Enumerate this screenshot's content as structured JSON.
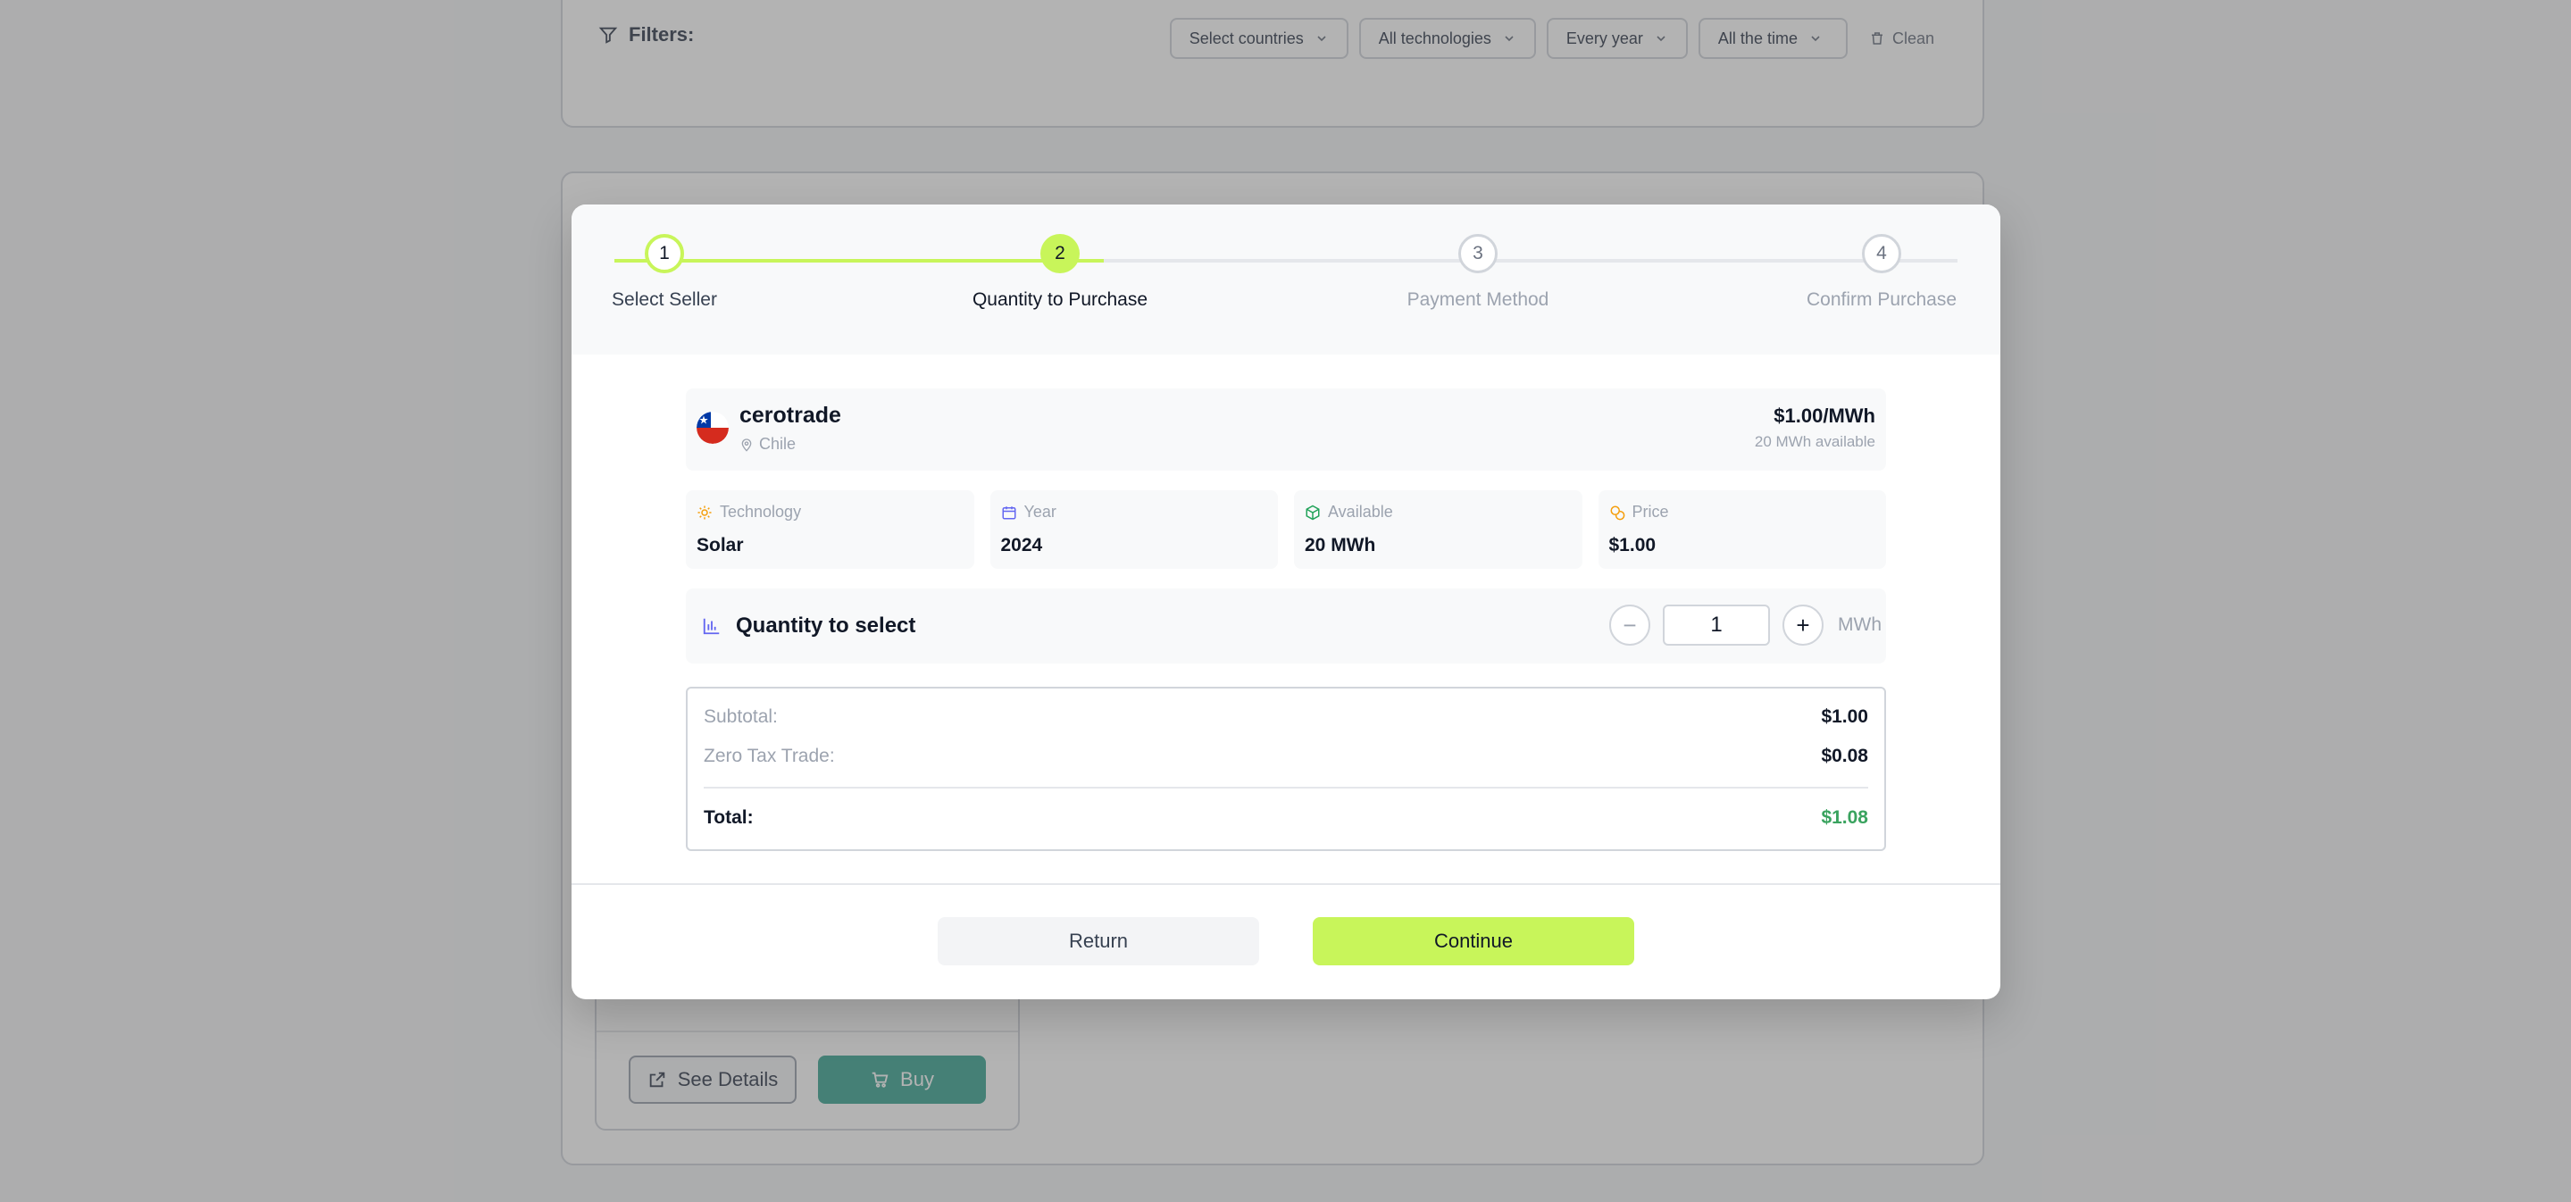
{
  "filters": {
    "title": "Filters:",
    "countries": "Select countries",
    "technologies": "All technologies",
    "year": "Every year",
    "time": "All the time",
    "clean": "Clean"
  },
  "offer_card": {
    "see_details": "See Details",
    "buy": "Buy"
  },
  "stepper": {
    "steps": [
      {
        "number": "1",
        "label": "Select Seller",
        "state": "done"
      },
      {
        "number": "2",
        "label": "Quantity to Purchase",
        "state": "active"
      },
      {
        "number": "3",
        "label": "Payment Method",
        "state": "pending"
      },
      {
        "number": "4",
        "label": "Confirm Purchase",
        "state": "pending"
      }
    ]
  },
  "seller": {
    "name": "cerotrade",
    "country": "Chile",
    "price": "$1.00/MWh",
    "available": "20 MWh available"
  },
  "stats": {
    "technology": {
      "label": "Technology",
      "value": "Solar"
    },
    "year": {
      "label": "Year",
      "value": "2024"
    },
    "available": {
      "label": "Available",
      "value": "20 MWh"
    },
    "price": {
      "label": "Price",
      "value": "$1.00"
    }
  },
  "quantity": {
    "title": "Quantity to select",
    "value": "1",
    "unit": "MWh",
    "minus": "−",
    "plus": "+"
  },
  "summary": {
    "subtotal_label": "Subtotal:",
    "subtotal_value": "$1.00",
    "tax_label": "Zero Tax Trade:",
    "tax_value": "$0.08",
    "total_label": "Total:",
    "total_value": "$1.08"
  },
  "actions": {
    "return": "Return",
    "continue": "Continue"
  },
  "colors": {
    "accent": "#c8f55a",
    "buy": "#43a896",
    "total": "#3aa35f"
  }
}
